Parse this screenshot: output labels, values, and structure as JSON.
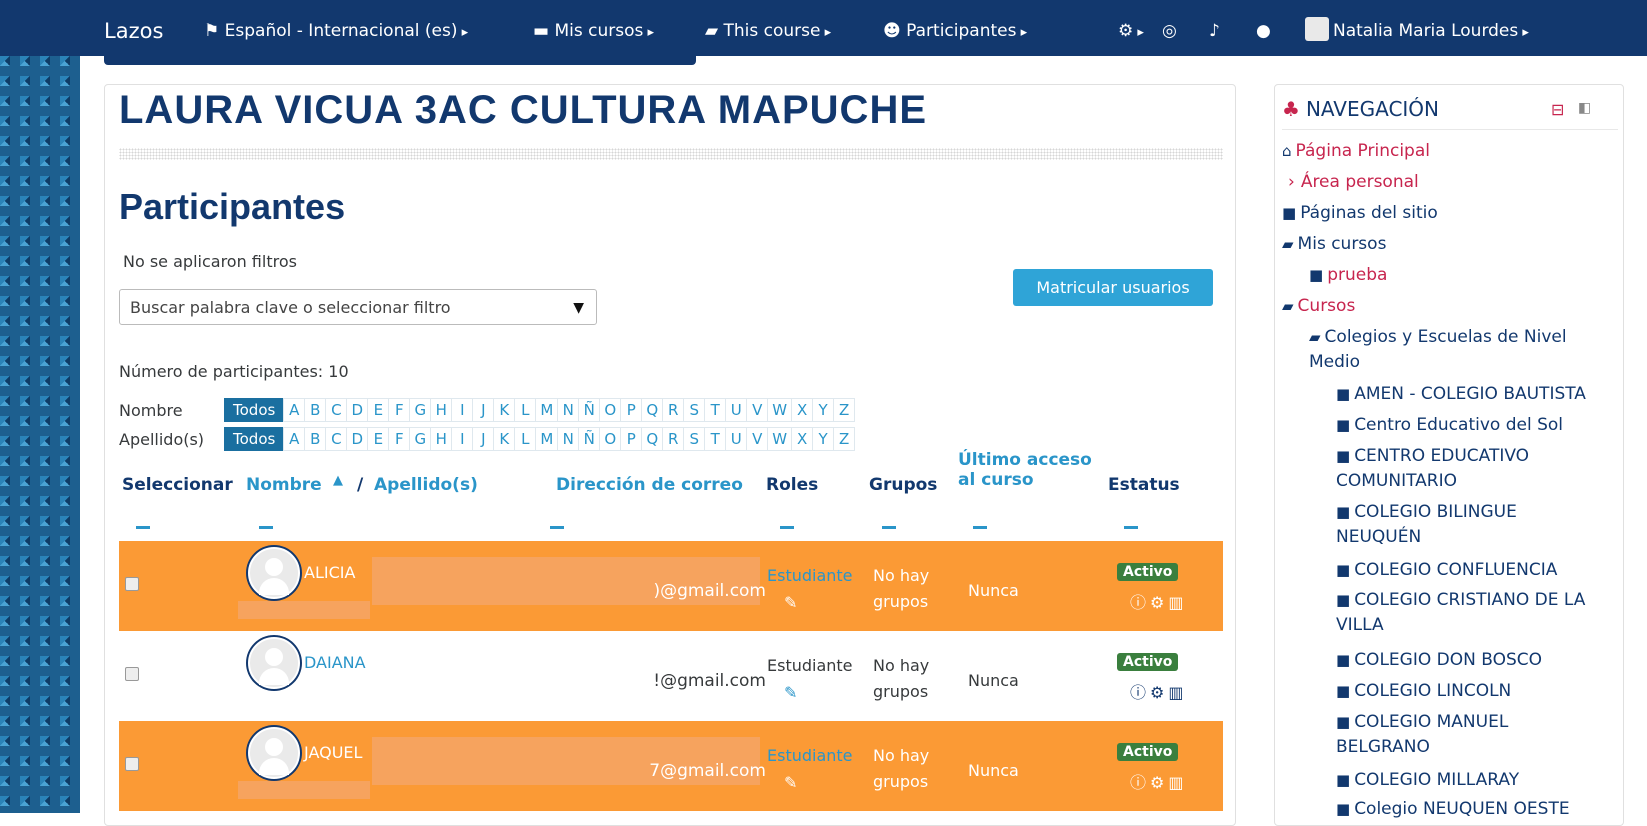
{
  "navbar": {
    "brand": "Lazos",
    "language": "Español - Internacional (es)",
    "my_courses": "Mis cursos",
    "this_course": "This course",
    "participants": "Participantes",
    "user_name": "Natalia Maria Lourdes"
  },
  "course": {
    "title": "LAURA VICUA 3AC CULTURA MAPUCHE"
  },
  "participants": {
    "heading": "Participantes",
    "no_filters": "No se aplicaron filtros",
    "filter_placeholder": "Buscar palabra clave o seleccionar filtro",
    "enrol_button": "Matricular usuarios",
    "count_label": "Número de participantes: 10",
    "first_name_label": "Nombre",
    "last_name_label": "Apellido(s)",
    "all_label": "Todos",
    "letters": [
      "A",
      "B",
      "C",
      "D",
      "E",
      "F",
      "G",
      "H",
      "I",
      "J",
      "K",
      "L",
      "M",
      "N",
      "Ñ",
      "O",
      "P",
      "Q",
      "R",
      "S",
      "T",
      "U",
      "V",
      "W",
      "X",
      "Y",
      "Z"
    ]
  },
  "table": {
    "headers": {
      "select": "Seleccionar",
      "first_name": "Nombre",
      "sort_indicator": "▲",
      "slash": "/",
      "last_name": "Apellido(s)",
      "email": "Dirección de correo",
      "roles": "Roles",
      "groups": "Grupos",
      "last_access_1": "Último acceso",
      "last_access_2": "al curso",
      "status": "Estatus"
    },
    "rows": [
      {
        "name": "ALICIA",
        "email": ")@gmail.com",
        "role": "Estudiante",
        "groups": "No hay grupos",
        "last_access": "Nunca",
        "status": "Activo"
      },
      {
        "name": "DAIANA",
        "email": "!@gmail.com",
        "role": "Estudiante",
        "groups": "No hay grupos",
        "last_access": "Nunca",
        "status": "Activo"
      },
      {
        "name": "JAQUEL",
        "email": "7@gmail.com",
        "role": "Estudiante",
        "groups": "No hay grupos",
        "last_access": "Nunca",
        "status": "Activo"
      }
    ]
  },
  "sidebar": {
    "title": "NAVEGACIÓN",
    "items": [
      {
        "label": "Página Principal"
      },
      {
        "label": "Área personal"
      },
      {
        "label": "Páginas del sitio"
      },
      {
        "label": "Mis cursos"
      },
      {
        "label": "prueba"
      },
      {
        "label": "Cursos"
      },
      {
        "label": "Colegios y Escuelas de Nivel Medio"
      },
      {
        "label": "AMEN - COLEGIO BAUTISTA"
      },
      {
        "label": "Centro Educativo del Sol"
      },
      {
        "label": "CENTRO EDUCATIVO COMUNITARIO"
      },
      {
        "label": "COLEGIO BILINGUE NEUQUÉN"
      },
      {
        "label": "COLEGIO CONFLUENCIA"
      },
      {
        "label": "COLEGIO CRISTIANO DE LA VILLA"
      },
      {
        "label": "COLEGIO DON BOSCO"
      },
      {
        "label": "COLEGIO LINCOLN"
      },
      {
        "label": "COLEGIO MANUEL BELGRANO"
      },
      {
        "label": "COLEGIO MILLARAY"
      },
      {
        "label": "Colegio NEUQUEN OESTE"
      }
    ]
  },
  "colors": {
    "navbar": "#12386e",
    "highlight_row": "#fb9a35",
    "link": "#2a95c9",
    "badge": "#3a7f3e",
    "sidebar_accent": "#c7254e"
  }
}
